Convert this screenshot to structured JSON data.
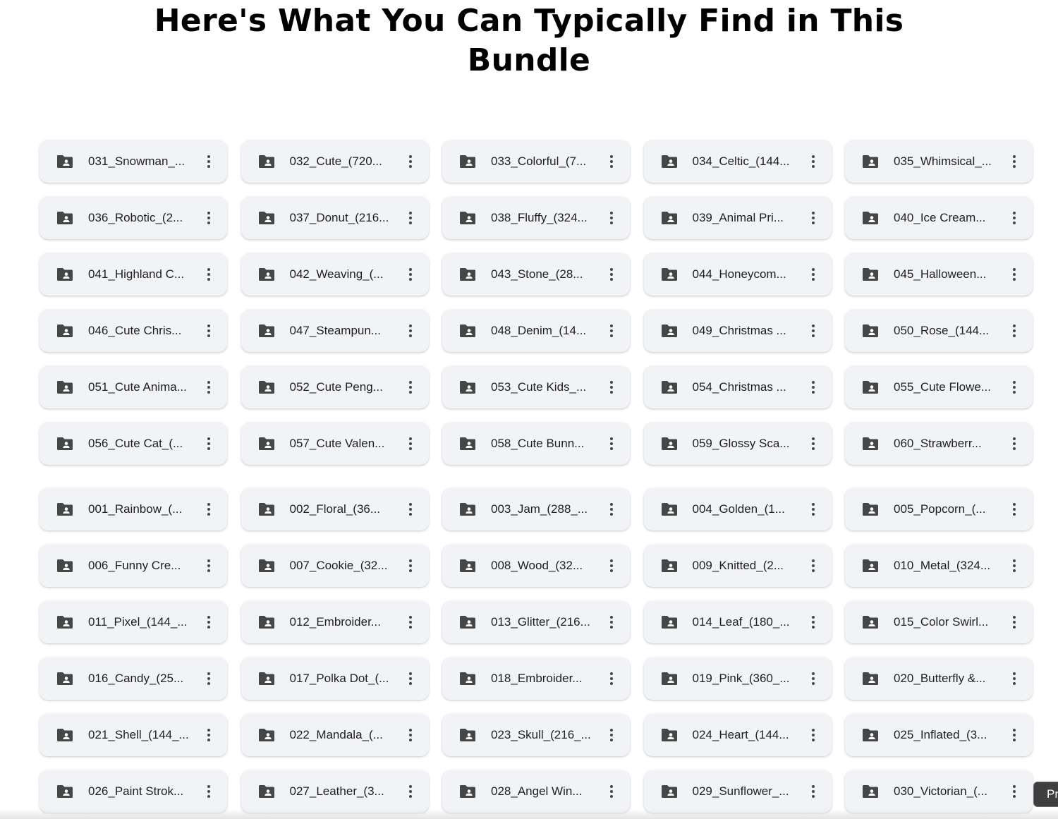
{
  "page": {
    "title_line1": "Here's What You Can Typically Find in This",
    "title_line2": "Bundle"
  },
  "icons": {
    "folder": "shared-folder-icon",
    "more": "more-vert-icon"
  },
  "colors": {
    "chip_background": "#f1f3f6",
    "icon": "#444746",
    "text": "#1f1f1f"
  },
  "folders_section_a": [
    "031_Snowman_...",
    "032_Cute_(720...",
    "033_Colorful_(7...",
    "034_Celtic_(144...",
    "035_Whimsical_...",
    "036_Robotic_(2...",
    "037_Donut_(216...",
    "038_Fluffy_(324...",
    "039_Animal Pri...",
    "040_Ice Cream...",
    "041_Highland C...",
    "042_Weaving_(...",
    "043_Stone_(28...",
    "044_Honeycom...",
    "045_Halloween...",
    "046_Cute Chris...",
    "047_Steampun...",
    "048_Denim_(14...",
    "049_Christmas ...",
    "050_Rose_(144...",
    "051_Cute Anima...",
    "052_Cute Peng...",
    "053_Cute Kids_...",
    "054_Christmas ...",
    "055_Cute Flowe...",
    "056_Cute Cat_(...",
    "057_Cute Valen...",
    "058_Cute Bunn...",
    "059_Glossy Sca...",
    "060_Strawberr..."
  ],
  "folders_section_b": [
    "001_Rainbow_(...",
    "002_Floral_(36...",
    "003_Jam_(288_...",
    "004_Golden_(1...",
    "005_Popcorn_(...",
    "006_Funny Cre...",
    "007_Cookie_(32...",
    "008_Wood_(32...",
    "009_Knitted_(2...",
    "010_Metal_(324...",
    "011_Pixel_(144_...",
    "012_Embroider...",
    "013_Glitter_(216...",
    "014_Leaf_(180_...",
    "015_Color Swirl...",
    "016_Candy_(25...",
    "017_Polka Dot_(...",
    "018_Embroider...",
    "019_Pink_(360_...",
    "020_Butterfly &...",
    "021_Shell_(144_...",
    "022_Mandala_(...",
    "023_Skull_(216_...",
    "024_Heart_(144...",
    "025_Inflated_(3...",
    "026_Paint Strok...",
    "027_Leather_(3...",
    "028_Angel Win...",
    "029_Sunflower_...",
    "030_Victorian_(..."
  ],
  "corner_button": {
    "label": "Pr"
  }
}
